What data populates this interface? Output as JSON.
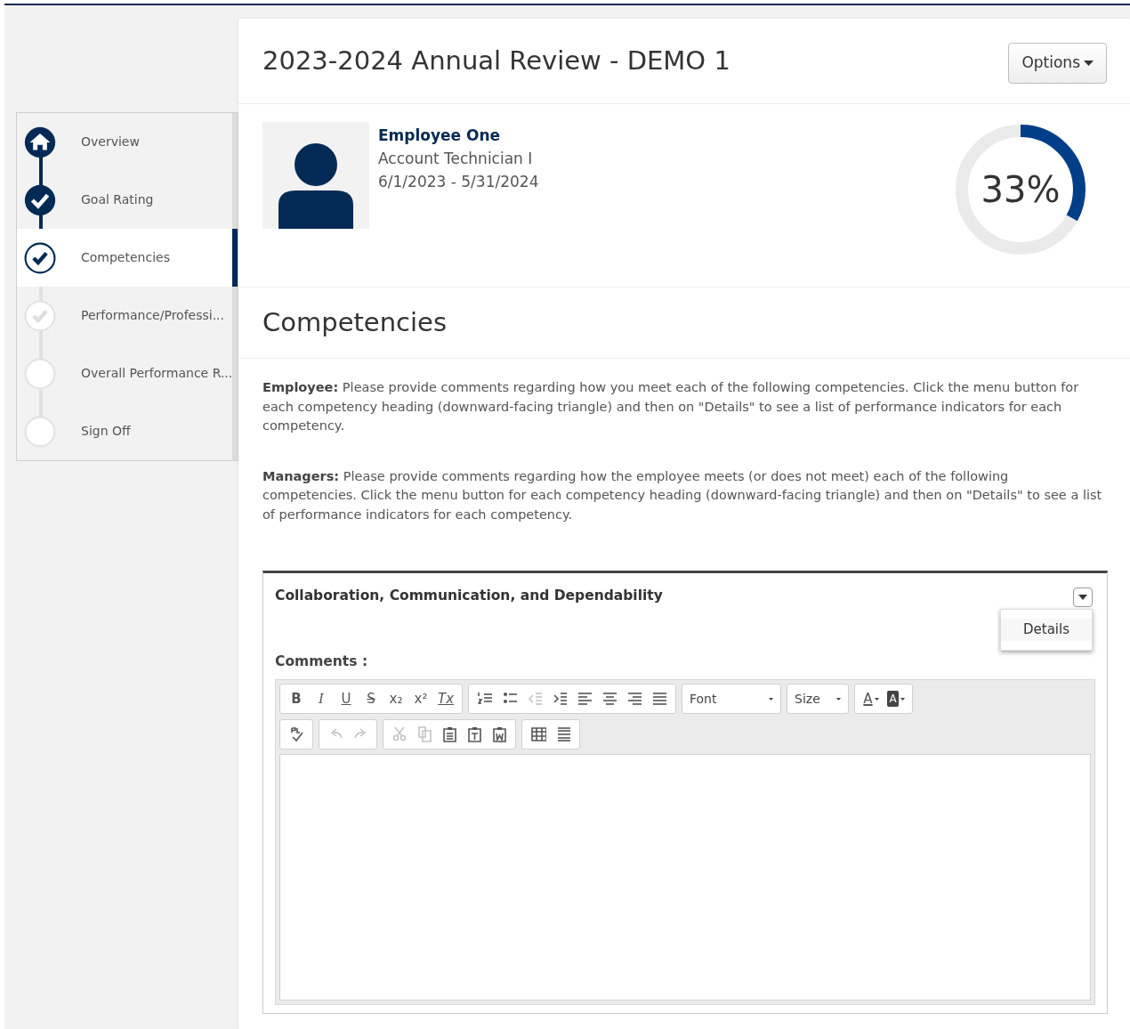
{
  "steps": [
    {
      "label": "Overview",
      "kind": "home",
      "selected": false
    },
    {
      "label": "Goal Rating",
      "kind": "done",
      "selected": false
    },
    {
      "label": "Competencies",
      "kind": "current",
      "selected": true
    },
    {
      "label": "Performance/Professi...",
      "kind": "partial",
      "selected": false
    },
    {
      "label": "Overall Performance R...",
      "kind": "todo",
      "selected": false
    },
    {
      "label": "Sign Off",
      "kind": "todo",
      "selected": false
    }
  ],
  "header": {
    "title": "2023-2024 Annual Review - DEMO 1",
    "options_button": "Options"
  },
  "employee": {
    "name": "Employee One",
    "job_title": "Account Technician I",
    "period": "6/1/2023 - 5/31/2024"
  },
  "progress": {
    "level": 0.33,
    "reading": "33%"
  },
  "section": {
    "title": "Competencies",
    "instructions": [
      "**Employee:** Please provide comments regarding how you meet each of the following competencies. Click the menu button for each competency heading (downward-facing triangle) and then on \"Details\" to see a list of performance indicators for each competency.",
      "**Managers:**  Please provide comments regarding how the employee meets (or does not meet) each of the following competencies. Click the menu button for each competency heading (downward-facing triangle) and then on \"Details\" to see a list of performance indicators for each competency."
    ]
  },
  "competency": {
    "title": "Collaboration, Communication, and Dependability",
    "menu": {
      "items": [
        "Details"
      ]
    },
    "comments_label": "Comments :",
    "toolbar": [
      [
        [
          {
            "kind": "bold",
            "label": "B"
          },
          {
            "kind": "italic",
            "label": "I"
          },
          {
            "kind": "underline",
            "label": "U"
          },
          {
            "kind": "strike",
            "label": "S"
          },
          {
            "kind": "subscript",
            "label": "x₂"
          },
          {
            "kind": "superscript",
            "label": "x²"
          },
          {
            "kind": "clear",
            "label": "Tx"
          }
        ],
        [
          {
            "kind": "numbered-list"
          },
          {
            "kind": "bullet-list"
          },
          {
            "kind": "outdent",
            "disabled": true
          },
          {
            "kind": "indent"
          },
          {
            "kind": "align-left"
          },
          {
            "kind": "align-center"
          },
          {
            "kind": "align-right"
          },
          {
            "kind": "justify"
          }
        ],
        [
          {
            "kind": "font",
            "label": "Font"
          }
        ],
        [
          {
            "kind": "size",
            "label": "Size"
          }
        ],
        [
          {
            "kind": "text-color",
            "label": "A"
          },
          {
            "kind": "background-color",
            "label": "A"
          }
        ]
      ],
      [
        [
          {
            "kind": "spellcheck"
          }
        ],
        [
          {
            "kind": "undo",
            "disabled": true
          },
          {
            "kind": "redo",
            "disabled": true
          }
        ],
        [
          {
            "kind": "cut",
            "disabled": true
          },
          {
            "kind": "copy",
            "disabled": true
          },
          {
            "kind": "paste"
          },
          {
            "kind": "paste-text"
          },
          {
            "kind": "paste-word"
          }
        ],
        [
          {
            "kind": "table"
          },
          {
            "kind": "horizontal-rule"
          }
        ]
      ]
    ]
  }
}
